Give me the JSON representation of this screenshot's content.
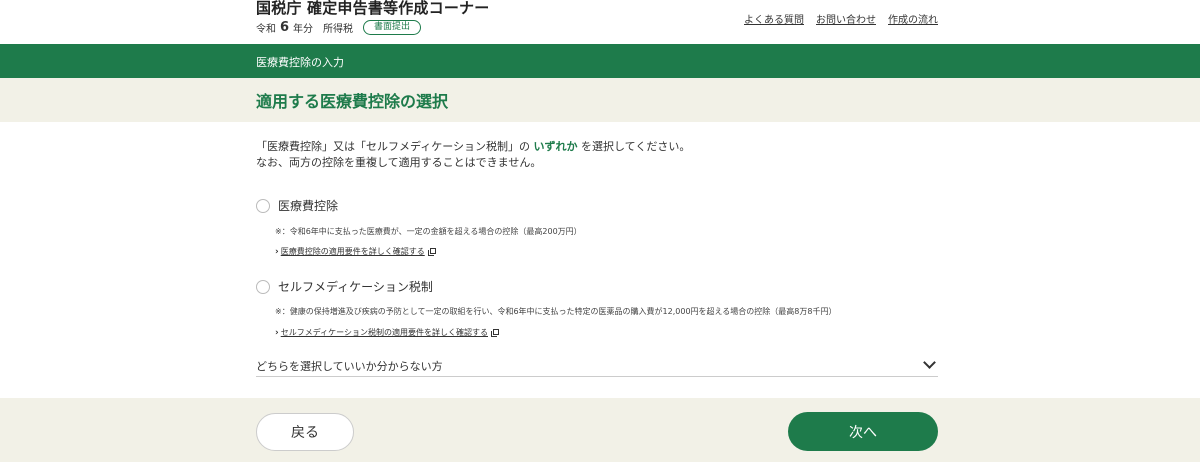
{
  "header": {
    "title": "国税庁 確定申告書等作成コーナー",
    "era": "令和",
    "year": "6",
    "year_suffix": "年分",
    "tax_type": "所得税",
    "mode_badge": "書面提出",
    "links": [
      "よくある質問",
      "お問い合わせ",
      "作成の流れ"
    ]
  },
  "step": {
    "label": "医療費控除の入力"
  },
  "page": {
    "title": "適用する医療費控除の選択"
  },
  "intro": {
    "line1_part1": "「医療費控除」又は「セルフメディケーション税制」の",
    "line1_emphasis": "いずれか",
    "line1_part2": "を選択してください。",
    "line2": "なお、両方の控除を重複して適用することはできません。"
  },
  "options": [
    {
      "label": "医療費控除",
      "note": "※：令和6年中に支払った医療費が、一定の金額を超える場合の控除（最高200万円）",
      "link": "医療費控除の適用要件を詳しく確認する"
    },
    {
      "label": "セルフメディケーション税制",
      "note": "※：健康の保持増進及び疾病の予防として一定の取組を行い、令和6年中に支払った特定の医薬品の購入費が12,000円を超える場合の控除（最高8万8千円）",
      "link": "セルフメディケーション税制の適用要件を詳しく確認する"
    }
  ],
  "accordion": {
    "label": "どちらを選択していいか分からない方"
  },
  "footer": {
    "back_label": "戻る",
    "next_label": "次へ"
  },
  "colors": {
    "accent": "#1e7b4b",
    "band": "#f2f1e7"
  }
}
